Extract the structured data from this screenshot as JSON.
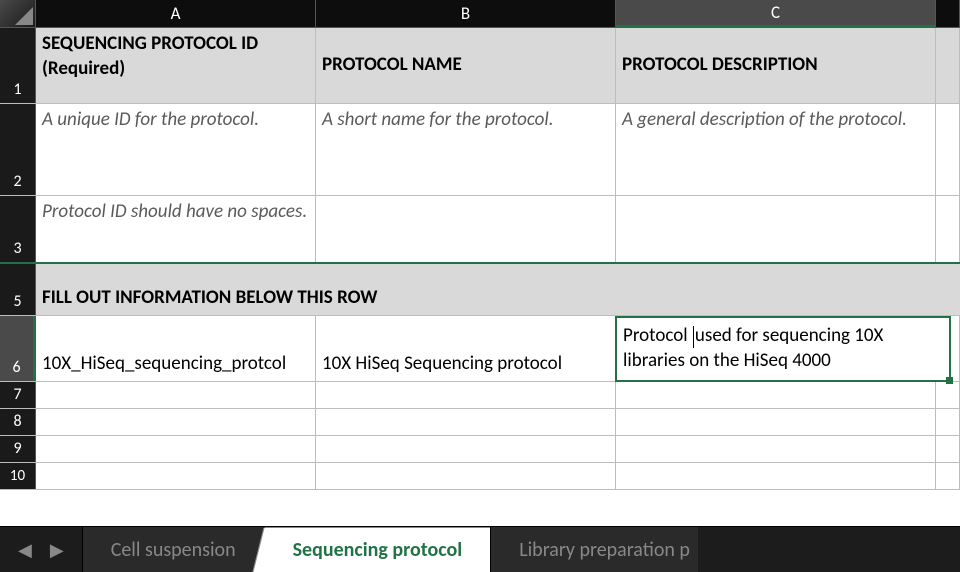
{
  "columns": {
    "A": "A",
    "B": "B",
    "C": "C"
  },
  "rows": {
    "r1": "1",
    "r2": "2",
    "r3": "3",
    "r5": "5",
    "r6": "6",
    "r7": "7",
    "r8": "8",
    "r9": "9",
    "r10": "10"
  },
  "cells": {
    "A1": "SEQUENCING PROTOCOL ID (Required)",
    "B1": "PROTOCOL NAME",
    "C1": "PROTOCOL DESCRIPTION",
    "A2": "A unique ID for the protocol.",
    "B2": "A short name for the protocol.",
    "C2": "A general description of the protocol.",
    "A3": "Protocol ID should have no spaces.",
    "A5": "FILL OUT INFORMATION BELOW THIS ROW",
    "A6": "10X_HiSeq_sequencing_protcol",
    "B6": "10X HiSeq Sequencing protocol",
    "C6_pre": "Protocol ",
    "C6_post": "used for sequencing 10X libraries on the HiSeq 4000"
  },
  "tabs": {
    "prev": "Cell suspension",
    "active": "Sequencing protocol",
    "next": "Library preparation p"
  },
  "active_cell": "C6",
  "chart_data": {
    "type": "table",
    "columns": [
      "SEQUENCING PROTOCOL ID (Required)",
      "PROTOCOL NAME",
      "PROTOCOL DESCRIPTION"
    ],
    "rows": [
      [
        "10X_HiSeq_sequencing_protcol",
        "10X HiSeq Sequencing protocol",
        "Protocol used for sequencing 10X libraries on the HiSeq 4000"
      ]
    ]
  }
}
